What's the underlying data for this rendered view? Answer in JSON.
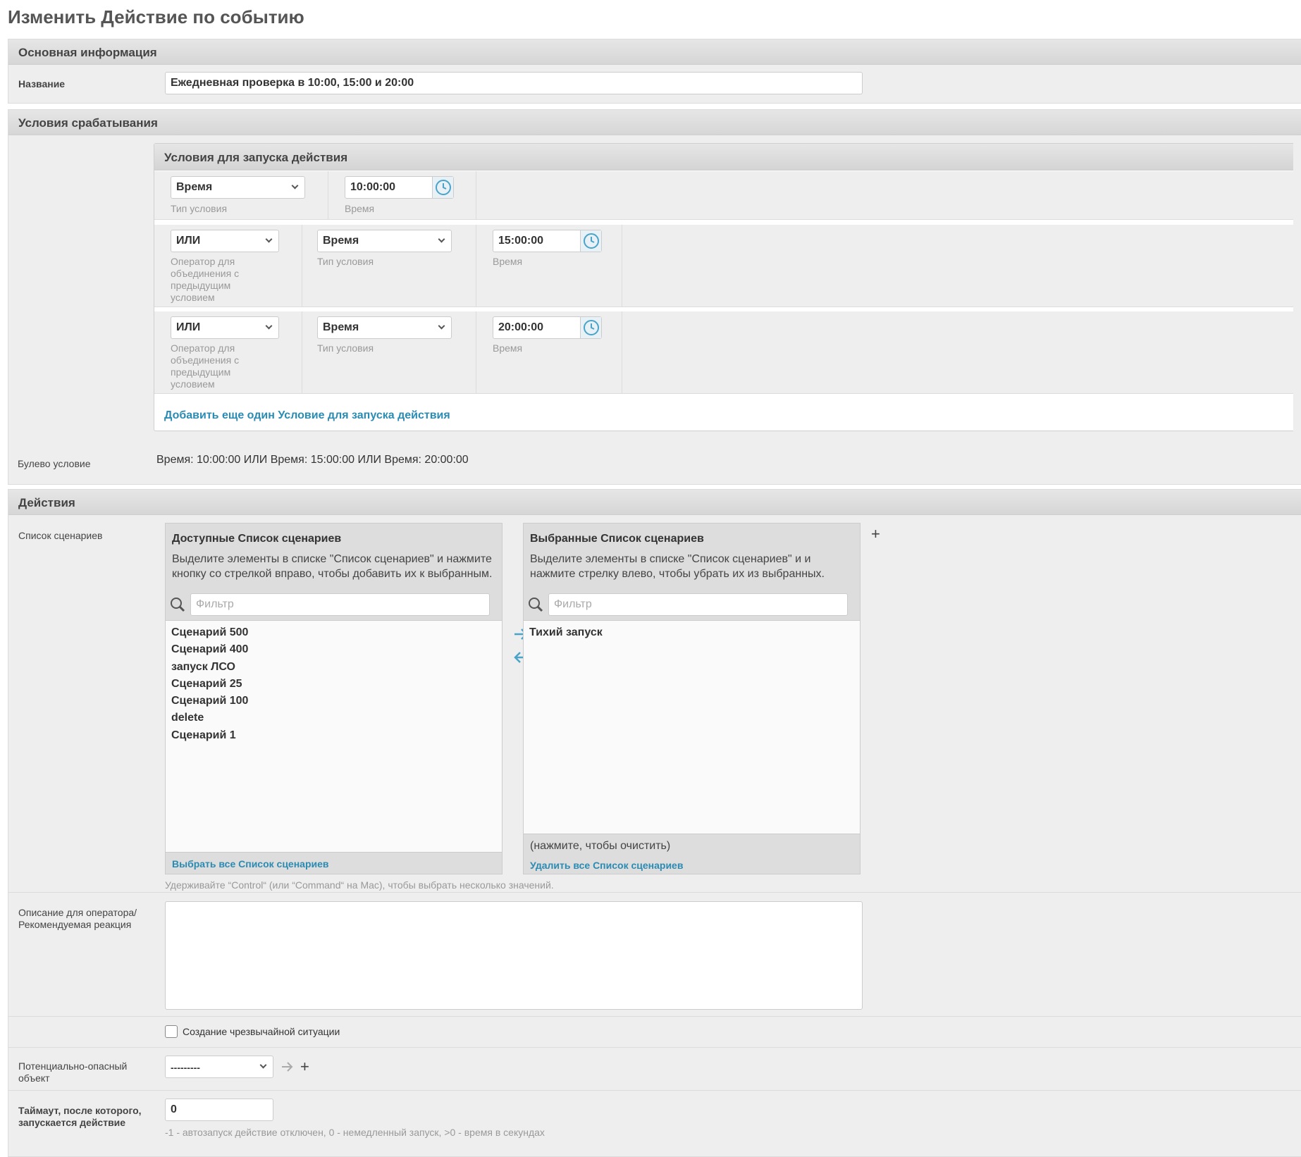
{
  "page_title": "Изменить Действие по событию",
  "sections": {
    "basic": "Основная информация",
    "trigger": "Условия срабатывания",
    "actions": "Действия"
  },
  "name_field": {
    "label": "Название",
    "value": "Ежедневная проверка в 10:00, 15:00 и 20:00"
  },
  "conditions": {
    "title": "Условия для запуска действия",
    "type_help": "Тип условия",
    "time_help": "Время",
    "operator_help": "Оператор для объединения с предыдущим условием",
    "rows": [
      {
        "operator": "",
        "type": "Время",
        "time": "10:00:00"
      },
      {
        "operator": "ИЛИ",
        "type": "Время",
        "time": "15:00:00"
      },
      {
        "operator": "ИЛИ",
        "type": "Время",
        "time": "20:00:00"
      }
    ],
    "add_link": "Добавить еще один Условие для запуска действия"
  },
  "boolean_condition": {
    "label": "Булево условие",
    "value": "Время: 10:00:00 ИЛИ Время: 15:00:00 ИЛИ Время: 20:00:00"
  },
  "scenarios": {
    "label": "Список сценариев",
    "available": {
      "title": "Доступные Список сценариев",
      "desc": "Выделите элементы в списке \"Список сценариев\" и нажмите кнопку со стрелкой вправо, чтобы добавить их к выбранным.",
      "filter_placeholder": "Фильтр",
      "items": [
        "Сценарий 500",
        "Сценарий 400",
        "запуск ЛСО",
        "Сценарий 25",
        "Сценарий 100",
        "delete",
        "Сценарий 1"
      ],
      "footer": "Выбрать все Список сценариев"
    },
    "chosen": {
      "title": "Выбранные Список сценариев",
      "desc": "Выделите элементы в списке \"Список сценариев\" и и нажмите стрелку влево, чтобы убрать их из выбранных.",
      "filter_placeholder": "Фильтр",
      "items": [
        "Тихий запуск"
      ],
      "clear_hint": "(нажмите, чтобы очистить)",
      "footer": "Удалить все Список сценариев"
    },
    "help": "Удерживайте “Control“ (или “Command“ на Mac), чтобы выбрать несколько значений."
  },
  "description": {
    "label": "Описание для оператора/ Рекомендуемая реакция",
    "value": ""
  },
  "emergency": {
    "label": "Создание чрезвычайной ситуации",
    "checked": false
  },
  "hazard_object": {
    "label": "Потенциально-опасный объект",
    "value": "---------"
  },
  "timeout": {
    "label": "Таймаут, после которого, запускается действие",
    "value": "0",
    "help": "-1 - автозапуск действие отключен, 0 - немедленный запуск, >0 - время в секундах"
  },
  "icons": {
    "clock": "clock-icon",
    "search": "search-icon",
    "arrow_right": "arrow-right-icon",
    "arrow_left": "arrow-left-icon",
    "plus": "plus-icon",
    "accent": "#2a8bb3"
  }
}
